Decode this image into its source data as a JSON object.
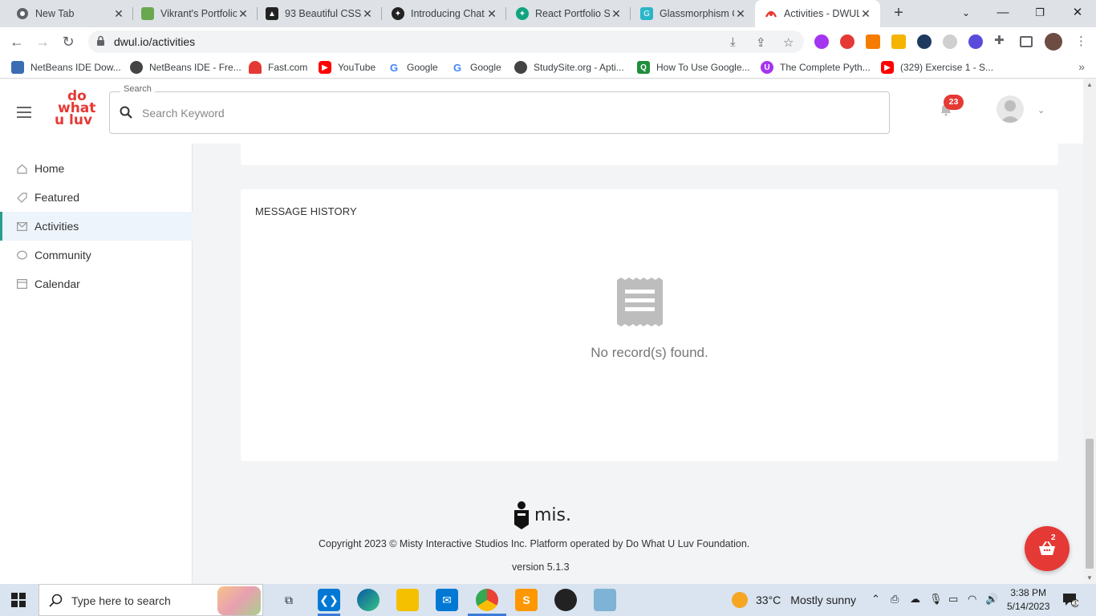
{
  "browser": {
    "tabs": [
      {
        "title": "New Tab",
        "favicon": "chrome-icon",
        "color": "#5f6368"
      },
      {
        "title": "Vikrant's Portfolio",
        "favicon": "portfolio-icon",
        "color": "#6aa84f"
      },
      {
        "title": "93 Beautiful CSS",
        "favicon": "css-icon",
        "color": "#222222"
      },
      {
        "title": "Introducing Chat",
        "favicon": "openai-icon",
        "color": "#222222"
      },
      {
        "title": "React Portfolio Si",
        "favicon": "openai-icon",
        "color": "#10a37f"
      },
      {
        "title": "Glassmorphism C",
        "favicon": "glass-icon",
        "color": "#2bb5c9"
      },
      {
        "title": "Activities - DWUL",
        "favicon": "dwul-icon",
        "color": "#e53935"
      }
    ],
    "address": "dwul.io/activities",
    "bookmarks": [
      {
        "label": "NetBeans IDE Dow...",
        "icon": "netbeans-icon",
        "color": "#3b6db3"
      },
      {
        "label": "NetBeans IDE - Fre...",
        "icon": "globe-icon",
        "color": "#444444"
      },
      {
        "label": "Fast.com",
        "icon": "speedometer-icon",
        "color": "#e53935"
      },
      {
        "label": "YouTube",
        "icon": "youtube-icon",
        "color": "#ff0000"
      },
      {
        "label": "Google",
        "icon": "google-icon",
        "color": "#4285f4"
      },
      {
        "label": "Google",
        "icon": "google-icon",
        "color": "#4285f4"
      },
      {
        "label": "StudySite.org - Apti...",
        "icon": "globe-icon",
        "color": "#444444"
      },
      {
        "label": "How To Use Google...",
        "icon": "quiz-icon",
        "color": "#1e8e3e"
      },
      {
        "label": "The Complete Pyth...",
        "icon": "udemy-icon",
        "color": "#a435f0"
      },
      {
        "label": "(329) Exercise 1 - S...",
        "icon": "youtube-icon",
        "color": "#ff0000"
      }
    ]
  },
  "header": {
    "logo_lines": [
      "do",
      "what",
      "u luv"
    ],
    "search_legend": "Search",
    "search_placeholder": "Search Keyword",
    "notification_count": "23"
  },
  "sidebar": {
    "items": [
      {
        "label": "Home",
        "icon": "home-icon"
      },
      {
        "label": "Featured",
        "icon": "tag-icon"
      },
      {
        "label": "Activities",
        "icon": "mail-icon",
        "active": true
      },
      {
        "label": "Community",
        "icon": "chat-icon"
      },
      {
        "label": "Calendar",
        "icon": "calendar-icon"
      }
    ]
  },
  "main": {
    "card_title": "MESSAGE HISTORY",
    "empty_text": "No record(s) found."
  },
  "footer": {
    "brand": "mis.",
    "copyright": "Copyright 2023 © Misty Interactive Studios Inc. Platform operated by Do What U Luv Foundation.",
    "version": "version 5.1.3"
  },
  "cart": {
    "count": "2"
  },
  "taskbar": {
    "search_text": "Type here to search",
    "weather_temp": "33°C",
    "weather_desc": "Mostly sunny",
    "time": "3:38 PM",
    "date": "5/14/2023",
    "notification_count": "3"
  },
  "colors": {
    "accent": "#e53935",
    "active_sidebar": "#2a9d8f"
  }
}
